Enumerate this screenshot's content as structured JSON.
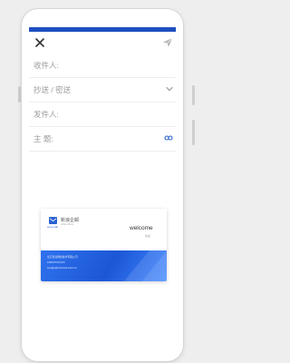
{
  "compose": {
    "to_label": "收件人:",
    "cc_bcc_label": "抄送 / 密送",
    "from_label": "发件人:",
    "subject_label": "主    题:"
  },
  "colors": {
    "accent": "#1e4fc0",
    "card_band": "#2f72ee"
  },
  "icons": {
    "close": "close-icon",
    "send": "send-icon",
    "expand": "chevron-down-icon",
    "attachment": "attachment-icon",
    "logo": "mail-logo-icon"
  },
  "signature_card": {
    "brand": "新浪企邮",
    "brand_sub": "SINA MAIL",
    "logo_caption": "sina mail",
    "welcome": "welcome",
    "welcome_sub": "欢迎",
    "company": "北京新浪网络技术有限公司",
    "phone": "138XXXXXXXX",
    "email": "kangjie@sinamail.sina.net"
  }
}
